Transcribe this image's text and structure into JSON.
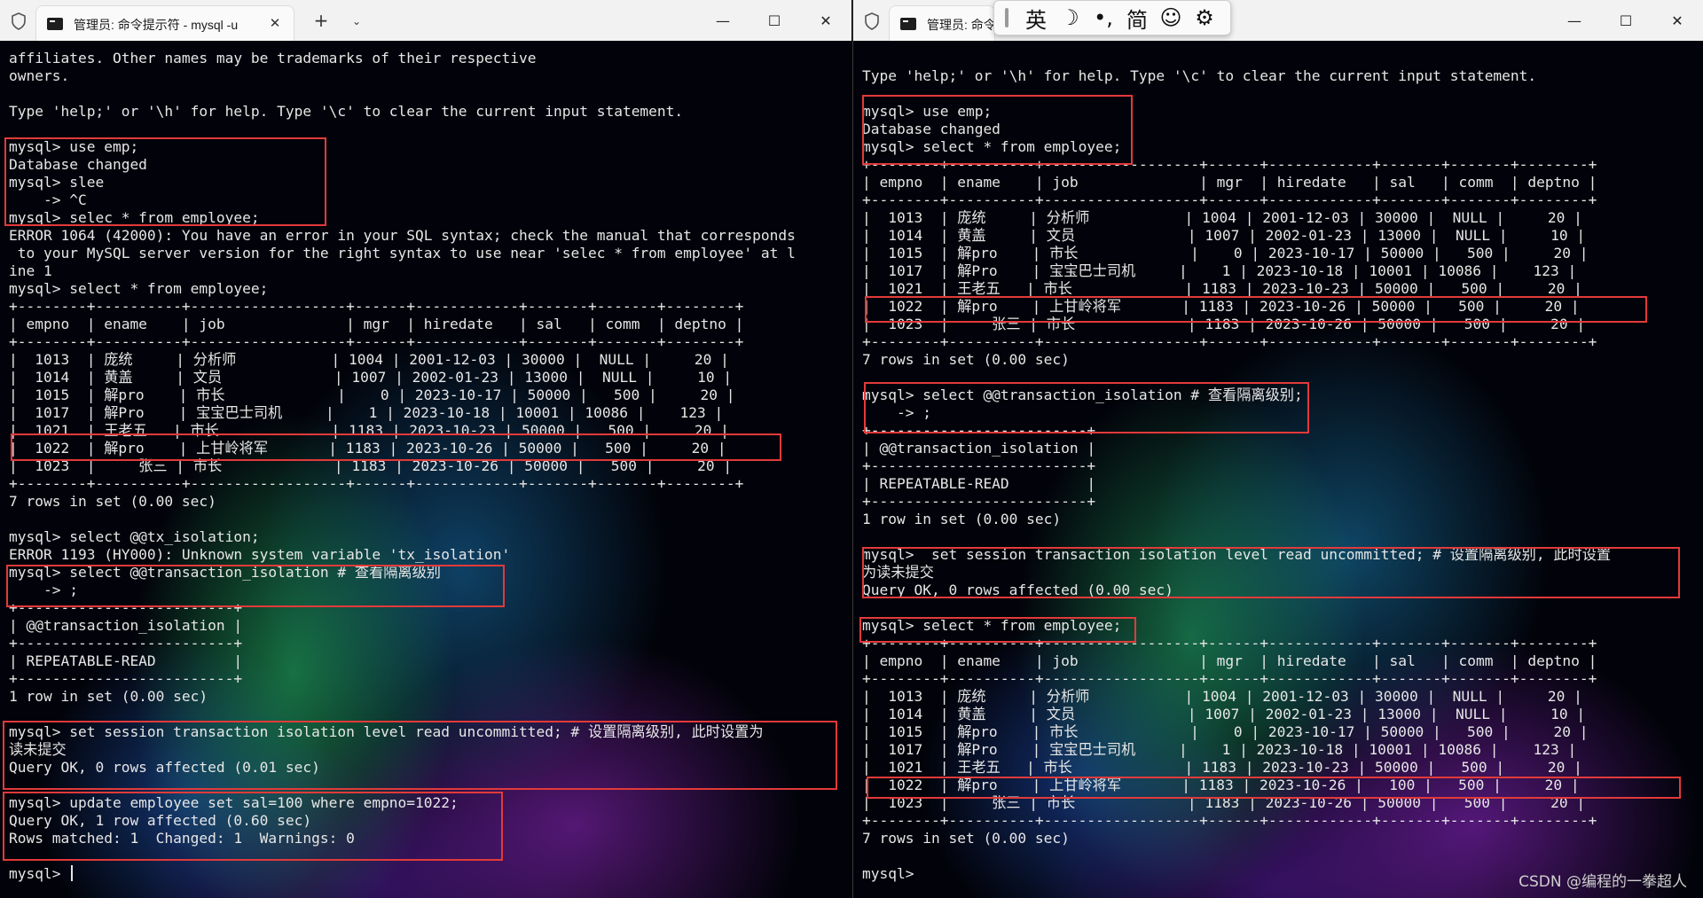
{
  "left_window": {
    "tab_title": "管理员: 命令提示符 - mysql  -u",
    "lines": [
      "affiliates. Other names may be trademarks of their respective",
      "owners.",
      "",
      "Type 'help;' or '\\h' for help. Type '\\c' to clear the current input statement.",
      "",
      "mysql> use emp;",
      "Database changed",
      "mysql> slee",
      "    -> ^C",
      "mysql> selec * from employee;",
      "ERROR 1064 (42000): You have an error in your SQL syntax; check the manual that corresponds",
      " to your MySQL server version for the right syntax to use near 'selec * from employee' at l",
      "ine 1",
      "mysql> select * from employee;",
      "+--------+----------+------------------+------+------------+-------+-------+--------+",
      "| empno  | ename    | job              | mgr  | hiredate   | sal   | comm  | deptno |",
      "+--------+----------+------------------+------+------------+-------+-------+--------+",
      "|  1013  | 庞统     | 分析师           | 1004 | 2001-12-03 | 30000 |  NULL |     20 |",
      "|  1014  | 黄盖     | 文员             | 1007 | 2002-01-23 | 13000 |  NULL |     10 |",
      "|  1015  | 解pro    | 市长             |    0 | 2023-10-17 | 50000 |   500 |     20 |",
      "|  1017  | 解Pro    | 宝宝巴士司机     |    1 | 2023-10-18 | 10001 | 10086 |    123 |",
      "|  1021  | 王老五   | 市长             | 1183 | 2023-10-23 | 50000 |   500 |     20 |",
      "|  1022  | 解pro    | 上甘岭将军       | 1183 | 2023-10-26 | 50000 |   500 |     20 |",
      "|  1023  |     张三 | 市长             | 1183 | 2023-10-26 | 50000 |   500 |     20 |",
      "+--------+----------+------------------+------+------------+-------+-------+--------+",
      "7 rows in set (0.00 sec)",
      "",
      "mysql> select @@tx_isolation;",
      "ERROR 1193 (HY000): Unknown system variable 'tx_isolation'",
      "mysql> select @@transaction_isolation # 查看隔离级别",
      "    -> ;",
      "+-------------------------+",
      "| @@transaction_isolation |",
      "+-------------------------+",
      "| REPEATABLE-READ         |",
      "+-------------------------+",
      "1 row in set (0.00 sec)",
      "",
      "mysql> set session transaction isolation level read uncommitted; # 设置隔离级别, 此时设置为",
      "读未提交",
      "Query OK, 0 rows affected (0.01 sec)",
      "",
      "mysql> update employee set sal=100 where empno=1022;",
      "Query OK, 1 row affected (0.60 sec)",
      "Rows matched: 1  Changed: 1  Warnings: 0",
      "",
      "mysql> "
    ]
  },
  "right_window": {
    "tab_title": "管理员: 命令提示符",
    "lines": [
      "",
      "Type 'help;' or '\\h' for help. Type '\\c' to clear the current input statement.",
      "",
      "mysql> use emp;",
      "Database changed",
      "mysql> select * from employee;",
      "+--------+----------+------------------+------+------------+-------+-------+--------+",
      "| empno  | ename    | job              | mgr  | hiredate   | sal   | comm  | deptno |",
      "+--------+----------+------------------+------+------------+-------+-------+--------+",
      "|  1013  | 庞统     | 分析师           | 1004 | 2001-12-03 | 30000 |  NULL |     20 |",
      "|  1014  | 黄盖     | 文员             | 1007 | 2002-01-23 | 13000 |  NULL |     10 |",
      "|  1015  | 解pro    | 市长             |    0 | 2023-10-17 | 50000 |   500 |     20 |",
      "|  1017  | 解Pro    | 宝宝巴士司机     |    1 | 2023-10-18 | 10001 | 10086 |    123 |",
      "|  1021  | 王老五   | 市长             | 1183 | 2023-10-23 | 50000 |   500 |     20 |",
      "|  1022  | 解pro    | 上甘岭将军       | 1183 | 2023-10-26 | 50000 |   500 |     20 |",
      "|  1023  |     张三 | 市长             | 1183 | 2023-10-26 | 50000 |   500 |     20 |",
      "+--------+----------+------------------+------+------------+-------+-------+--------+",
      "7 rows in set (0.00 sec)",
      "",
      "mysql> select @@transaction_isolation # 查看隔离级别;",
      "    -> ;",
      "+-------------------------+",
      "| @@transaction_isolation |",
      "+-------------------------+",
      "| REPEATABLE-READ         |",
      "+-------------------------+",
      "1 row in set (0.00 sec)",
      "",
      "mysql>  set session transaction isolation level read uncommitted; # 设置隔离级别, 此时设置",
      "为读未提交",
      "Query OK, 0 rows affected (0.00 sec)",
      "",
      "mysql> select * from employee;",
      "+--------+----------+------------------+------+------------+-------+-------+--------+",
      "| empno  | ename    | job              | mgr  | hiredate   | sal   | comm  | deptno |",
      "+--------+----------+------------------+------+------------+-------+-------+--------+",
      "|  1013  | 庞统     | 分析师           | 1004 | 2001-12-03 | 30000 |  NULL |     20 |",
      "|  1014  | 黄盖     | 文员             | 1007 | 2002-01-23 | 13000 |  NULL |     10 |",
      "|  1015  | 解pro    | 市长             |    0 | 2023-10-17 | 50000 |   500 |     20 |",
      "|  1017  | 解Pro    | 宝宝巴士司机     |    1 | 2023-10-18 | 10001 | 10086 |    123 |",
      "|  1021  | 王老五   | 市长             | 1183 | 2023-10-23 | 50000 |   500 |     20 |",
      "|  1022  | 解pro    | 上甘岭将军       | 1183 | 2023-10-26 |   100 |   500 |     20 |",
      "|  1023  |     张三 | 市长             | 1183 | 2023-10-26 | 50000 |   500 |     20 |",
      "+--------+----------+------------------+------+------------+-------+-------+--------+",
      "7 rows in set (0.00 sec)",
      "",
      "mysql> "
    ]
  },
  "ime_toolbar": {
    "lang": "英",
    "moon": "☽",
    "punct": "•,",
    "simplified": "简",
    "emoji": "☺",
    "settings": "⚙"
  },
  "window_controls": {
    "minimize": "—",
    "maximize": "☐",
    "close": "✕"
  },
  "tab_close": "✕",
  "new_tab": "+",
  "tab_dropdown": "⌄",
  "watermark": "CSDN @编程的一拳超人",
  "colors": {
    "highlight": "#e23a3a",
    "text": "#e6e6e6",
    "titlebar": "#f2f2f2"
  }
}
